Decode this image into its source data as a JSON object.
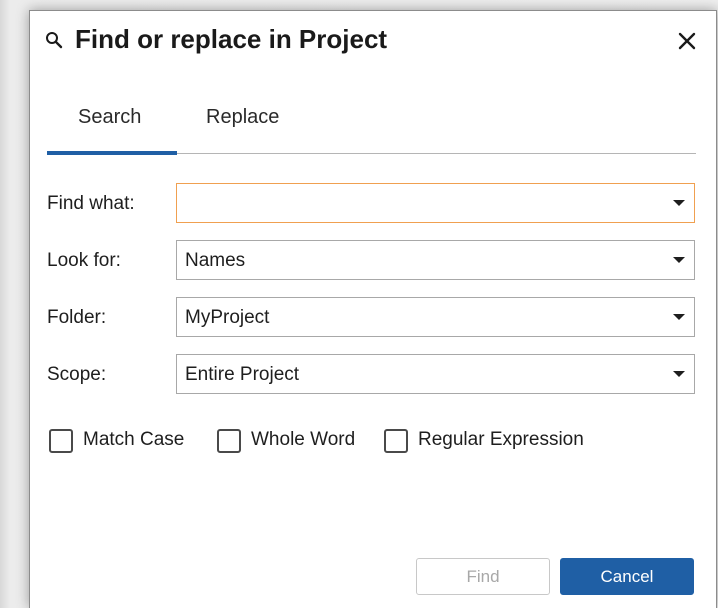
{
  "dialog": {
    "title": "Find or replace in Project",
    "title_icon": "search-icon",
    "close_icon": "close-icon"
  },
  "tabs": [
    {
      "label": "Search",
      "active": true
    },
    {
      "label": "Replace",
      "active": false
    }
  ],
  "form": {
    "find_what": {
      "label": "Find what:",
      "value": ""
    },
    "look_for": {
      "label": "Look for:",
      "value": "Names"
    },
    "folder": {
      "label": "Folder:",
      "value": "MyProject"
    },
    "scope": {
      "label": "Scope:",
      "value": "Entire Project"
    }
  },
  "options": [
    {
      "label": "Match Case",
      "checked": false
    },
    {
      "label": "Whole Word",
      "checked": false
    },
    {
      "label": "Regular Expression",
      "checked": false
    }
  ],
  "buttons": {
    "find_label": "Find",
    "find_enabled": false,
    "cancel_label": "Cancel"
  },
  "colors": {
    "accent": "#1f5fa5",
    "focus_border": "#f0a050",
    "disabled_text": "#a8a8a8"
  }
}
